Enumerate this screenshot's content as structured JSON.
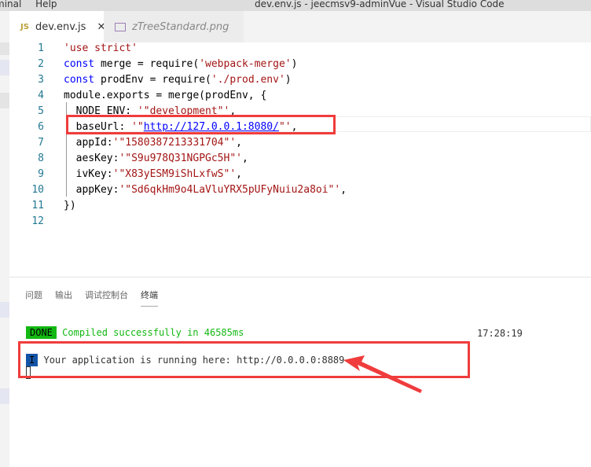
{
  "menu": [
    "minal",
    "Help"
  ],
  "window_title": "dev.env.js - jeecmsv9-adminVue - Visual Studio Code",
  "tabs": [
    {
      "label": "dev.env.js",
      "icon": "JS",
      "close": "✕"
    },
    {
      "label": "zTreeStandard.png"
    }
  ],
  "code_lines": [
    {
      "n": "1",
      "html": "<span class='str'>'use strict'</span>"
    },
    {
      "n": "2",
      "html": "<span class='kw'>const</span> merge = require(<span class='str'>'webpack-merge'</span>)"
    },
    {
      "n": "3",
      "html": "<span class='kw'>const</span> prodEnv = require(<span class='str'>'./prod.env'</span>)"
    },
    {
      "n": "4",
      "html": "module.exports = merge(prodEnv, {"
    },
    {
      "n": "5",
      "html": "  NODE_ENV: <span class='str'>'\"development\"'</span>,"
    },
    {
      "n": "6",
      "html": "  baseUrl: <span class='str'>'\"</span><span class='url'>http://127.0.0.1:8080/</span><span class='str'>\"'</span>,"
    },
    {
      "n": "7",
      "html": "  appId:<span class='str'>'\"1580387213331704\"'</span>,"
    },
    {
      "n": "8",
      "html": "  aesKey:<span class='str'>'\"S9u978Q31NGPGc5H\"'</span>,"
    },
    {
      "n": "9",
      "html": "  ivKey:<span class='str'>'\"X83yESM9iShLxfwS\"'</span>,"
    },
    {
      "n": "10",
      "html": "  appKey:<span class='str'>'\"Sd6qkHm9o4LaVluYRX5pUFyNuiu2a8oi\"'</span>,"
    },
    {
      "n": "11",
      "html": "})"
    },
    {
      "n": "12",
      "html": ""
    }
  ],
  "panel_tabs": [
    "问题",
    "输出",
    "调试控制台",
    "终端"
  ],
  "terminal": {
    "done_badge": "DONE",
    "compiled": "Compiled successfully in 46585ms",
    "time": "17:28:19",
    "info_badge": "I",
    "running": "Your application is running here: http://0.0.0.0:8889"
  }
}
